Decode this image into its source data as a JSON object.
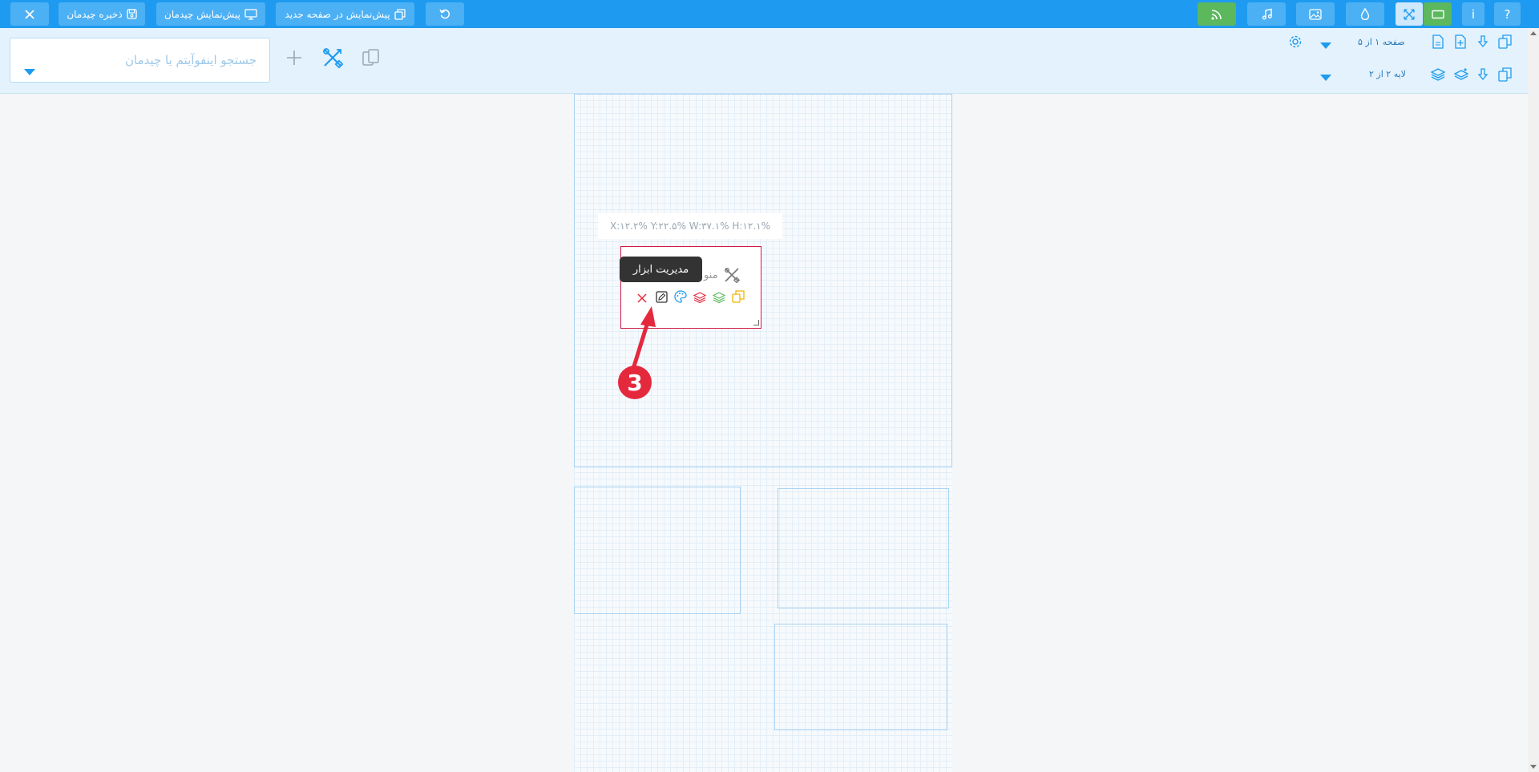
{
  "topbar": {
    "close_icon": "close-icon",
    "save_layout_label": "ذخیره چیدمان",
    "preview_layout_label": "پیش‌نمایش چیدمان",
    "preview_new_page_label": "پیش‌نمایش در صفحه جدید",
    "undo_icon": "undo-icon",
    "rss_icon": "rss-icon",
    "music_icon": "music-icon",
    "image_icon": "image-icon",
    "drop_icon": "drop-icon",
    "fullscreen_icon": "expand-icon",
    "rectangle_icon": "rectangle-icon",
    "info_label": "i",
    "help_label": "?"
  },
  "toolbar": {
    "search_placeholder": "جستجو اینفوآیتم یا چیدمان",
    "page_nav_label": "صفحه ۱ از ۵",
    "layer_nav_label": "لایه ۲ از ۲"
  },
  "canvas": {
    "coords_text": "X:۱۲.۲% Y:۲۲.۵% W:۳۷.۱% H:۱۲.۱%",
    "widget_title": "منو",
    "tooltip_text": "مدیریت ابزار",
    "step_badge": "3"
  },
  "colors": {
    "primary": "#1e9bf0",
    "green": "#5bb85d",
    "widget_border": "#d11a45",
    "badge": "#e5293d"
  }
}
